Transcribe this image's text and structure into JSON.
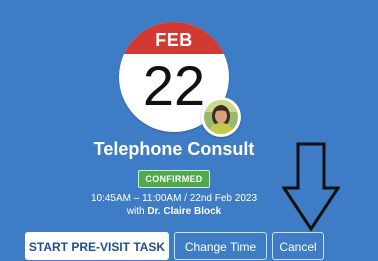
{
  "calendar": {
    "month": "FEB",
    "day": "22"
  },
  "appointment": {
    "title": "Telephone Consult",
    "status": "CONFIRMED",
    "time": "10:45AM – 11:00AM / 22nd Feb 2023",
    "with_prefix": "with ",
    "doctor": "Dr. Claire Block"
  },
  "actions": {
    "start_label": "START PRE-VISIT TASK",
    "change_label": "Change Time",
    "cancel_label": "Cancel"
  },
  "colors": {
    "background": "#3f7cc6",
    "calendar_header": "#d13a33",
    "status_badge": "#4fa84a"
  },
  "icons": {
    "avatar": "doctor-avatar-icon",
    "arrow": "arrow-down-icon"
  }
}
